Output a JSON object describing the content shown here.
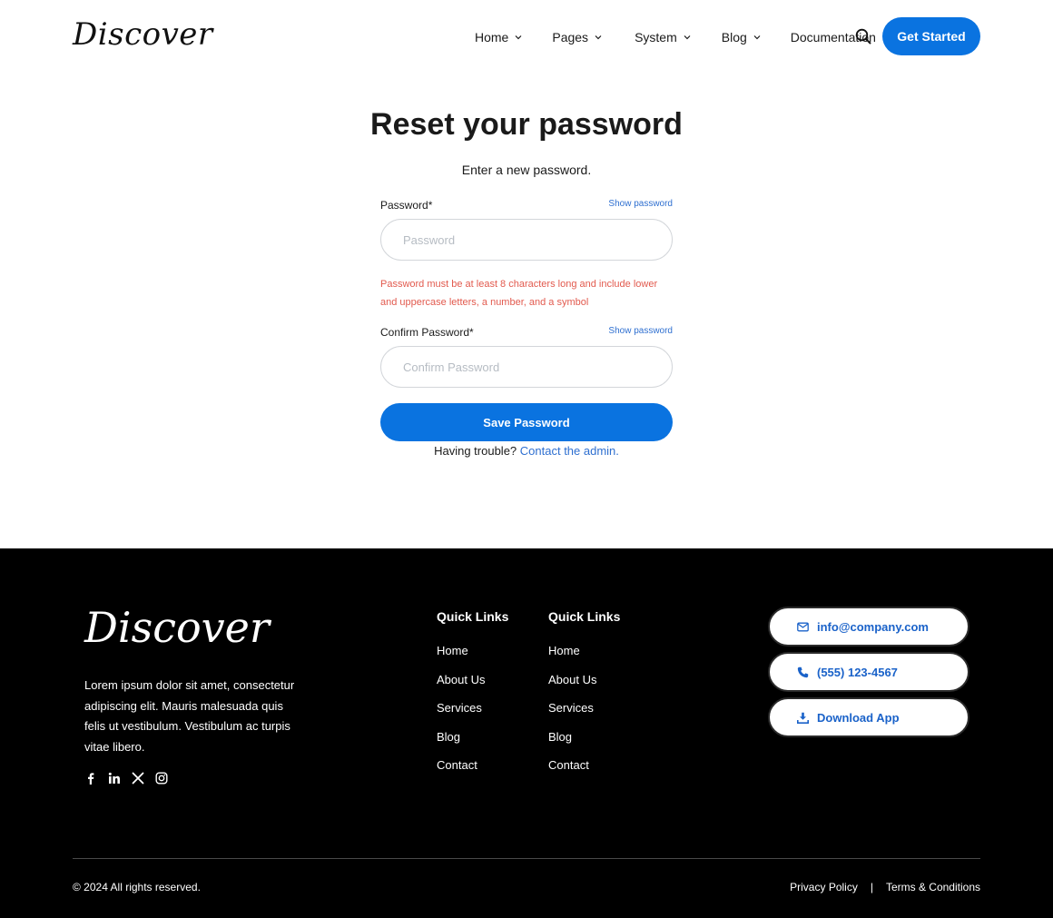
{
  "header": {
    "logo": "Discover",
    "nav": [
      {
        "label": "Home",
        "has_dropdown": true
      },
      {
        "label": "Pages",
        "has_dropdown": true
      },
      {
        "label": "System",
        "has_dropdown": true
      },
      {
        "label": "Blog",
        "has_dropdown": true
      },
      {
        "label": "Documentation",
        "has_dropdown": false
      }
    ],
    "search_icon": "search-icon",
    "cta_label": "Get Started"
  },
  "main": {
    "title": "Reset your password",
    "subtitle": "Enter a new password.",
    "password": {
      "label": "Password*",
      "show_label": "Show password",
      "placeholder": "Password",
      "value": "",
      "error": "Password must be at least 8 characters long and include lower and uppercase letters, a number, and a symbol"
    },
    "confirm": {
      "label": "Confirm Password*",
      "show_label": "Show password",
      "placeholder": "Confirm Password",
      "value": ""
    },
    "save_label": "Save Password",
    "trouble_text": "Having trouble?",
    "contact_link": "Contact the admin."
  },
  "footer": {
    "logo": "Discover",
    "description": "Lorem ipsum dolor sit amet, consectetur adipiscing elit. Mauris malesuada quis felis ut vestibulum. Vestibulum ac turpis vitae libero.",
    "social": [
      "facebook-icon",
      "linkedin-icon",
      "x-icon",
      "instagram-icon"
    ],
    "columns": [
      {
        "heading": "Quick Links",
        "links": [
          "Home",
          "About Us",
          "Services",
          "Blog",
          "Contact"
        ]
      },
      {
        "heading": "Quick Links",
        "links": [
          "Home",
          "About Us",
          "Services",
          "Blog",
          "Contact"
        ]
      }
    ],
    "contacts": [
      {
        "icon": "mail-icon",
        "label": "info@company.com"
      },
      {
        "icon": "phone-icon",
        "label": "(555) 123-4567"
      },
      {
        "icon": "download-icon",
        "label": "Download App"
      }
    ],
    "copyright": "© 2024 All rights reserved.",
    "legal": {
      "privacy": "Privacy Policy",
      "separator": "|",
      "terms": "Terms & Conditions"
    }
  },
  "colors": {
    "accent": "#0a73e0",
    "link": "#2e6fd0",
    "error": "#e25a4e",
    "footer_bg": "#000000"
  }
}
